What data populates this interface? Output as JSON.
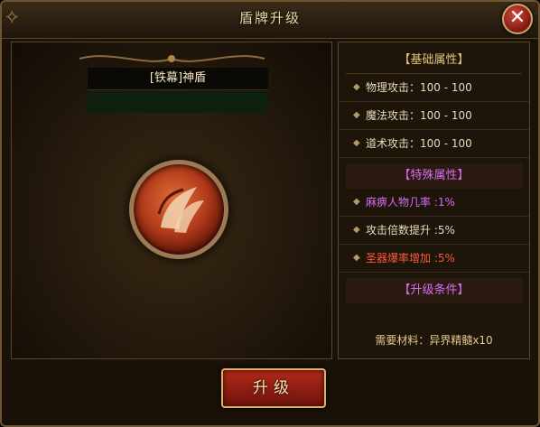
{
  "window": {
    "title": "盾牌升级"
  },
  "item": {
    "name": "[铁幕]神盾"
  },
  "basic": {
    "header": "【基础属性】",
    "attrs": [
      {
        "label": "物理攻击：100 - 100"
      },
      {
        "label": "魔法攻击：100 - 100"
      },
      {
        "label": "道术攻击：100 - 100"
      }
    ]
  },
  "special": {
    "header": "【特殊属性】",
    "attrs": [
      {
        "label": "麻痹人物几率 :1%",
        "color": "#d56df2"
      },
      {
        "label": "攻击倍数提升 :5%",
        "color": "#eadbb8"
      },
      {
        "label": "圣器爆率增加 :5%",
        "color": "#ff5a3a"
      }
    ]
  },
  "condition": {
    "header": "【升级条件】",
    "need": "需要材料：异界精髓x10"
  },
  "buttons": {
    "upgrade_label": "升级"
  },
  "colors": {
    "accent": "#d9b26a",
    "pink": "#d56df2",
    "red": "#ff5a3a"
  }
}
